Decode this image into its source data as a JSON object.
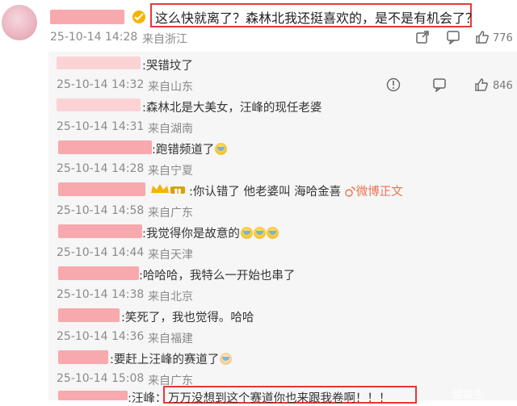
{
  "comment": {
    "text": "这么快就离了？森林北我还挺喜欢的，是不是有机会了？",
    "time": "25-10-14 14:28",
    "location": "来自浙江",
    "likes": "776"
  },
  "replies": [
    {
      "text": ":哭错坟了",
      "time": "25-10-14 14:32",
      "location": "来自山东",
      "likes": "846"
    },
    {
      "text": ":森林北是大美女，汪峰的现任老婆",
      "time": "25-10-14 14:31",
      "location": "来自湖南"
    },
    {
      "text": ":跑错频道了",
      "time": "25-10-14 14:28",
      "location": "来自宁夏"
    },
    {
      "text": ":你认错了 他老婆叫 海哈金喜",
      "link": "微博正文",
      "time": "25-10-14 14:58",
      "location": "来自广东"
    },
    {
      "text": ":我觉得你是故意的",
      "time": "25-10-14 14:44",
      "location": "来自天津"
    },
    {
      "text": ":哈哈哈，我特么一开始也串了",
      "time": "25-10-14 14:38",
      "location": "来自北京"
    },
    {
      "text": ":笑死了，我也觉得。哈哈",
      "time": "25-10-14 14:36",
      "location": "来自福建"
    },
    {
      "text": ":要赶上汪峰的赛道了",
      "time": "25-10-14 15:08",
      "location": "来自广东"
    },
    {
      "text": ":汪峰：",
      "text2": "万万没想到这个赛道你也来跟我卷啊！！！"
    }
  ],
  "watermark": "健康生",
  "icons": [
    "share-icon",
    "comment-icon",
    "thumbs-up-icon",
    "more-icon",
    "laugh-cry-emoji",
    "cat-emoji",
    "crown-badge"
  ]
}
